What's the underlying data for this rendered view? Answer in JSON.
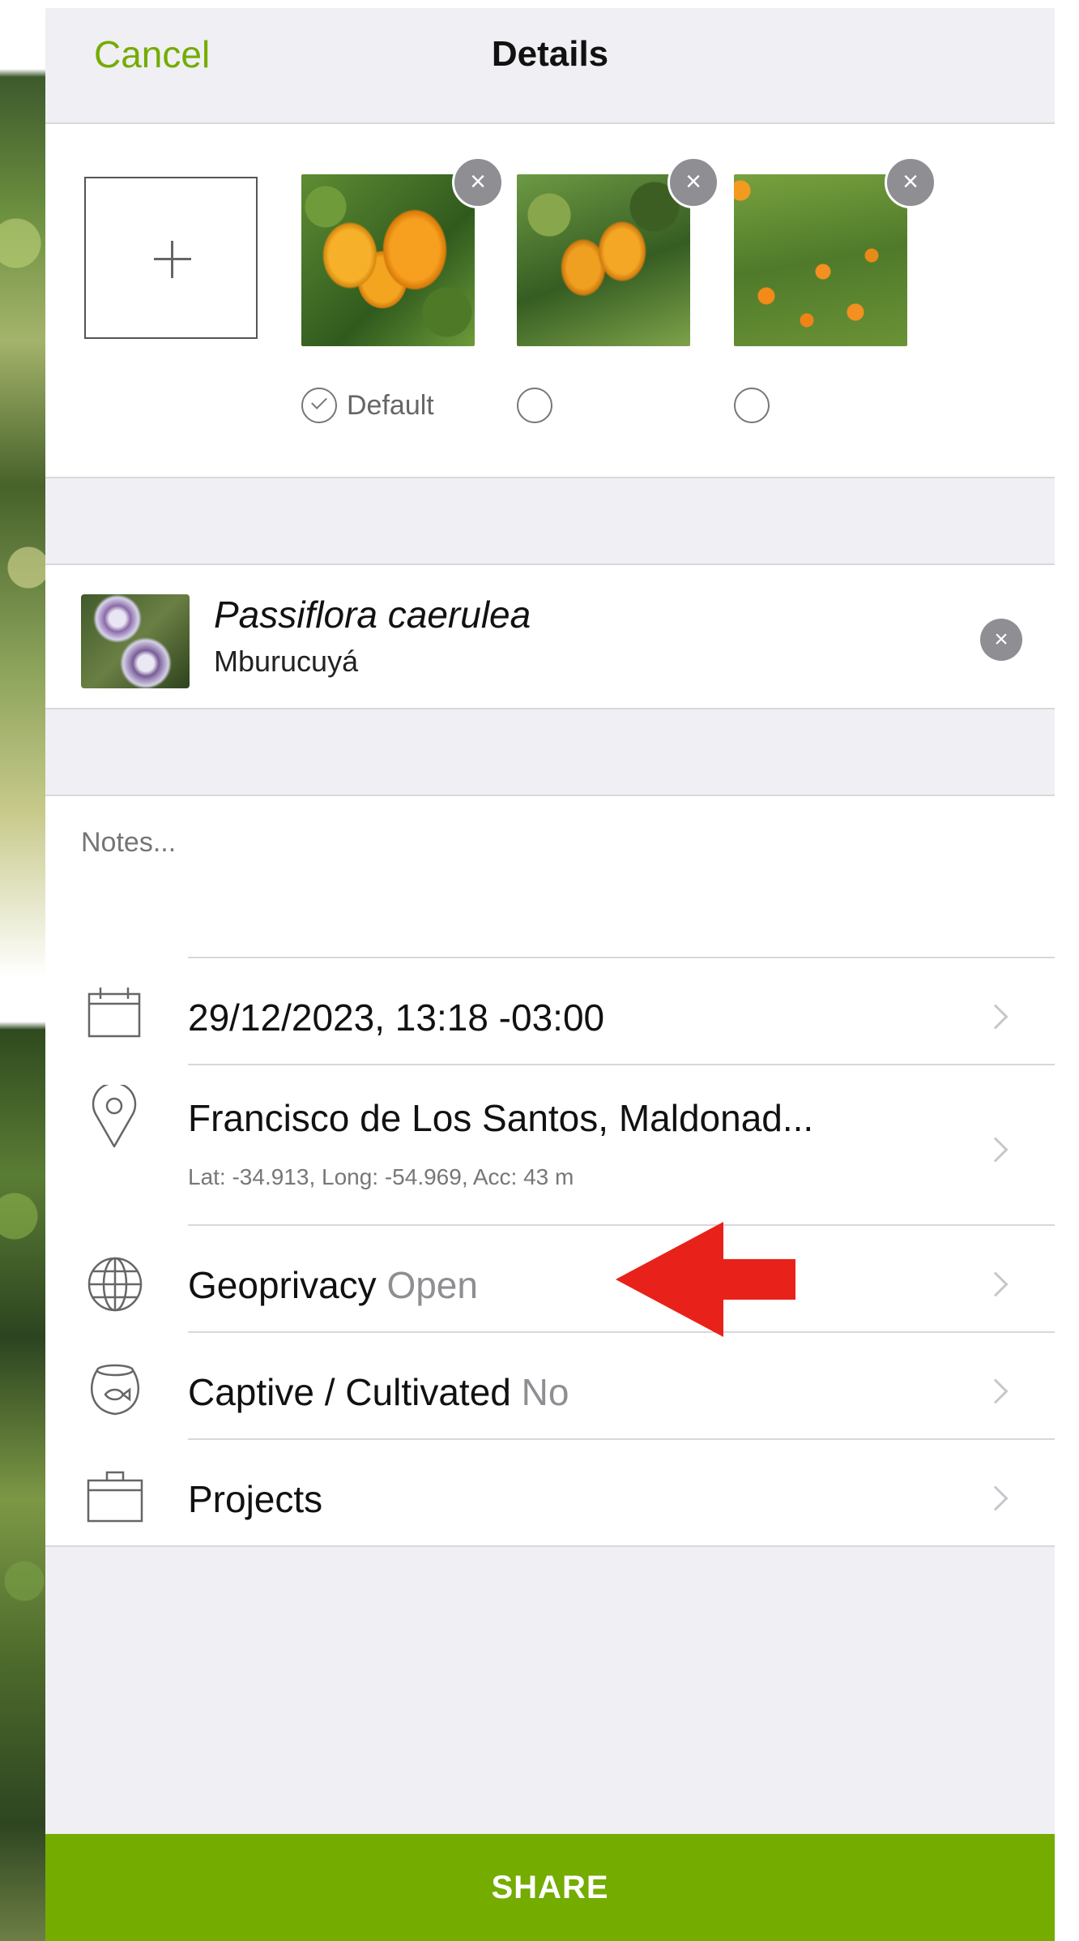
{
  "header": {
    "cancel_label": "Cancel",
    "title": "Details"
  },
  "photos": {
    "remove_glyph": "×",
    "default_label": "Default",
    "items": [
      {
        "name": "photo-1",
        "default": true
      },
      {
        "name": "photo-2",
        "default": false
      },
      {
        "name": "photo-3",
        "default": false
      }
    ]
  },
  "taxon": {
    "scientific_name": "Passiflora caerulea",
    "common_name": "Mburucuyá",
    "clear_glyph": "×"
  },
  "notes": {
    "placeholder": "Notes..."
  },
  "details": {
    "date": "29/12/2023, 13:18 -03:00",
    "location": "Francisco de Los Santos, Maldonad...",
    "coordinates": "Lat: -34.913, Long: -54.969, Acc: 43 m",
    "geoprivacy_label": "Geoprivacy",
    "geoprivacy_value": "Open",
    "captive_label": "Captive / Cultivated",
    "captive_value": "No",
    "projects_label": "Projects"
  },
  "share_label": "SHARE",
  "colors": {
    "accent": "#74ac00",
    "annotation_arrow": "#e8221a",
    "header_bg": "#efeff4"
  },
  "icons": [
    "plus-icon",
    "close-icon",
    "check-icon",
    "calendar-icon",
    "location-pin-icon",
    "globe-icon",
    "fishbowl-icon",
    "briefcase-icon",
    "chevron-right-icon"
  ]
}
